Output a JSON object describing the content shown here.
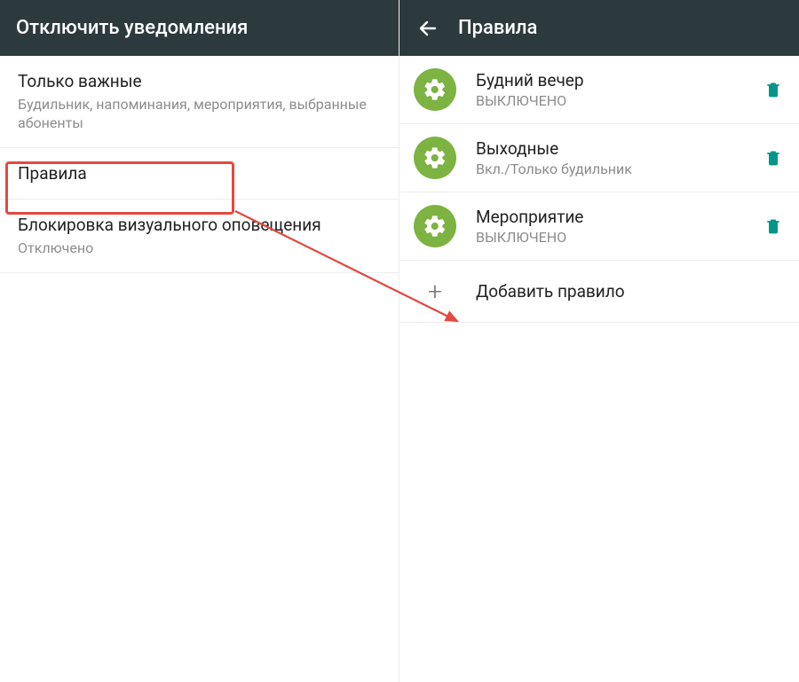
{
  "left": {
    "header_title": "Отключить уведомления",
    "items": [
      {
        "title": "Только важные",
        "subtitle": "Будильник, напоминания, мероприятия, выбранные абоненты"
      },
      {
        "title": "Правила",
        "subtitle": ""
      },
      {
        "title": "Блокировка визуального оповещения",
        "subtitle": "Отключено"
      }
    ]
  },
  "right": {
    "header_title": "Правила",
    "rules": [
      {
        "title": "Будний вечер",
        "subtitle": "ВЫКЛЮЧЕНО"
      },
      {
        "title": "Выходные",
        "subtitle": "Вкл./Только будильник"
      },
      {
        "title": "Мероприятие",
        "subtitle": "ВЫКЛЮЧЕНО"
      }
    ],
    "add_label": "Добавить правило"
  },
  "colors": {
    "header_bg": "#2d3a3d",
    "accent_green": "#7cb342",
    "teal": "#009688",
    "highlight_red": "#e24a40"
  }
}
